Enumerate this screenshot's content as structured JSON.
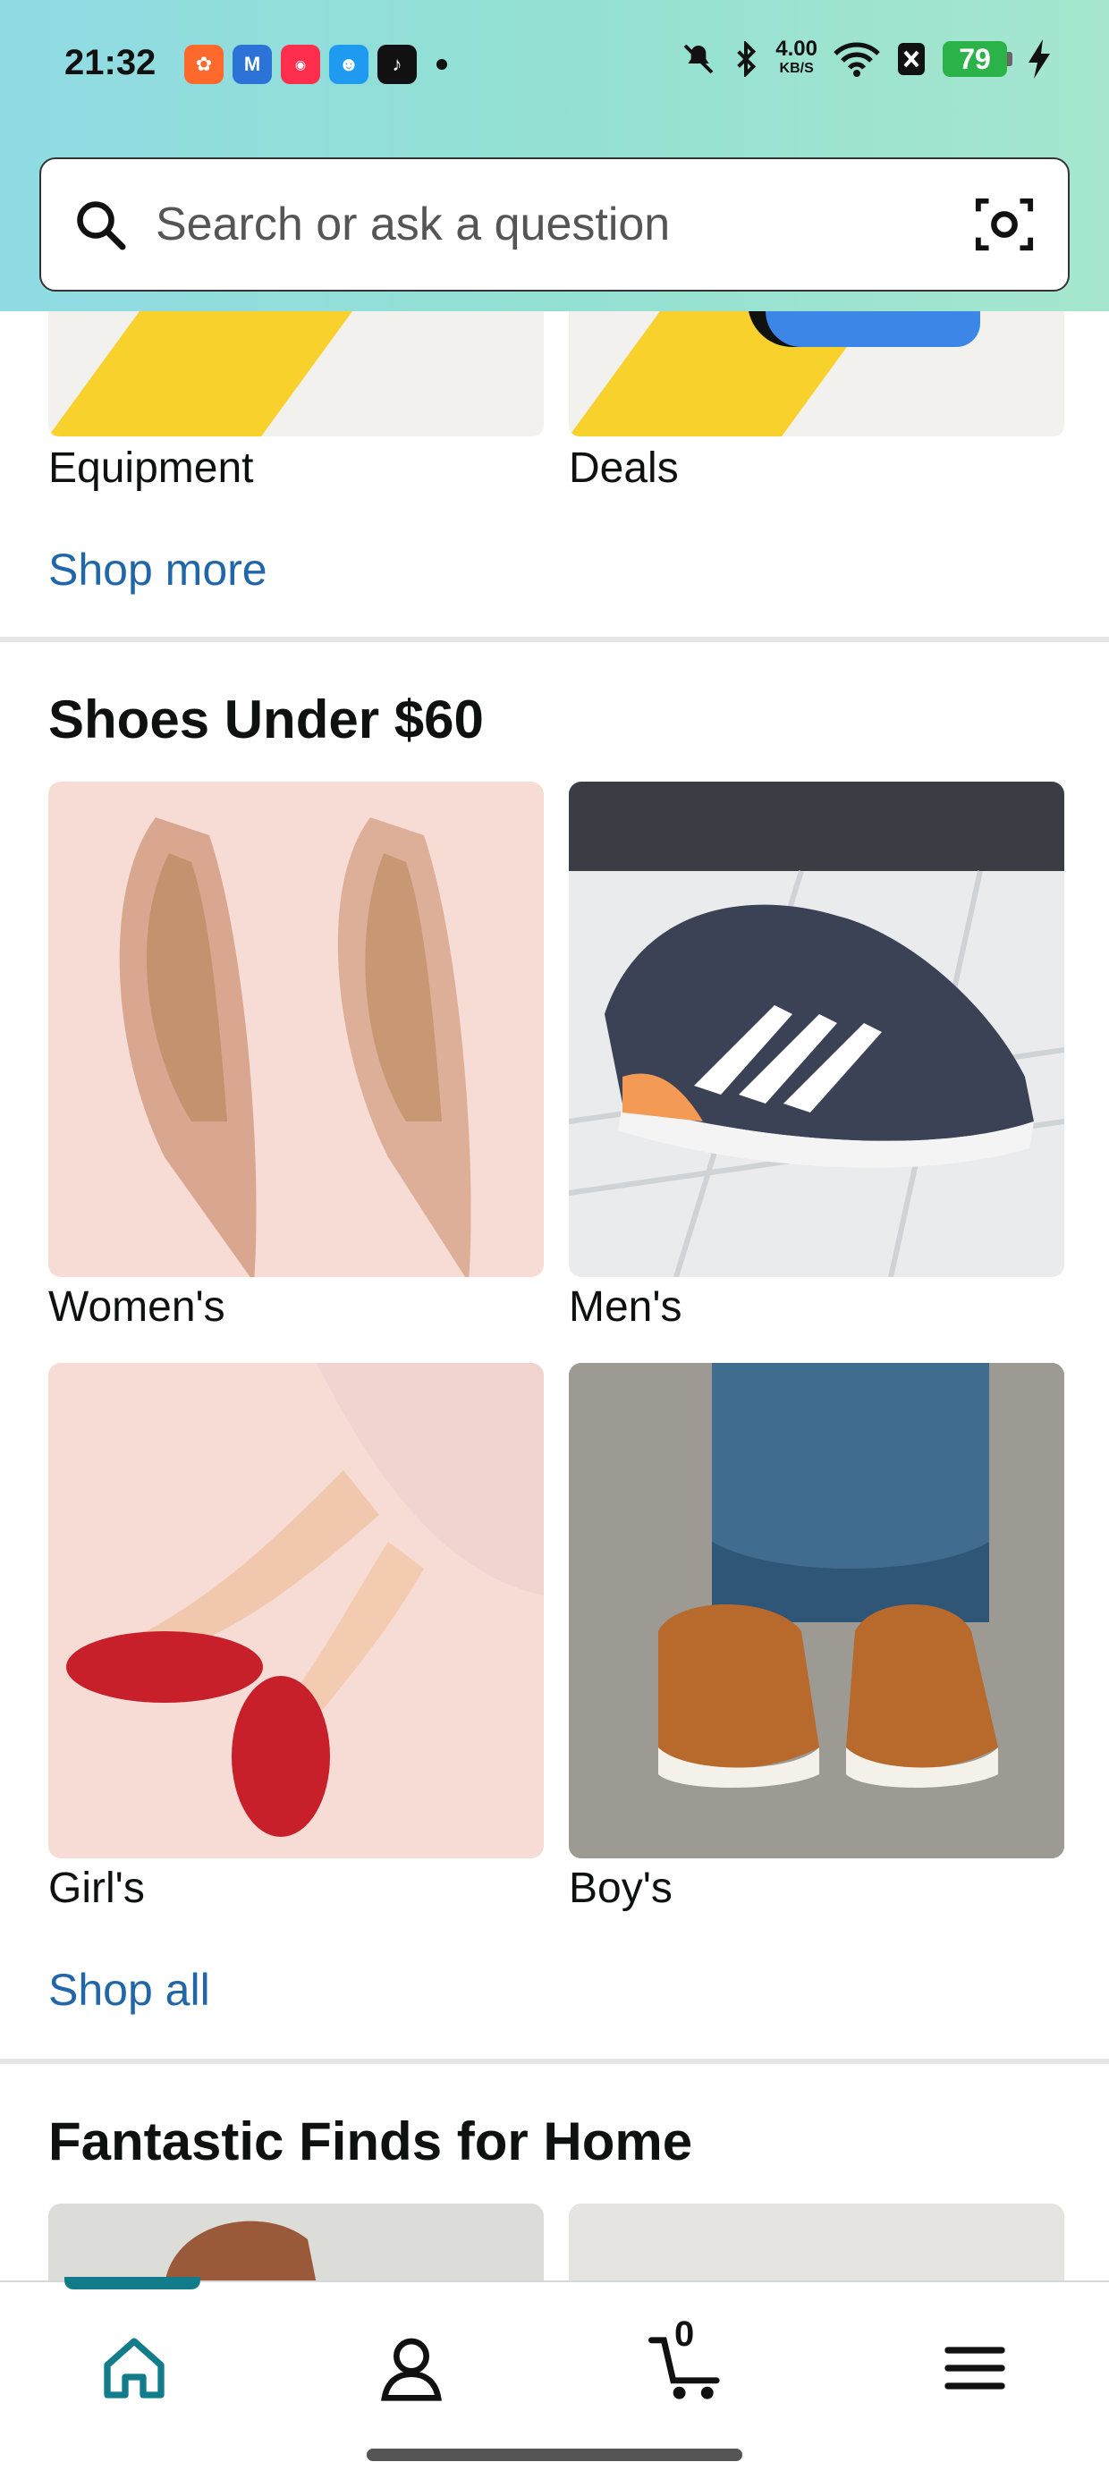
{
  "status_bar": {
    "time": "21:32",
    "network_speed": "4.00",
    "network_unit": "KB/S",
    "battery": "79"
  },
  "search": {
    "placeholder": "Search or ask a question"
  },
  "categories": [
    {
      "label": "Equipment"
    },
    {
      "label": "Deals"
    }
  ],
  "shop_more": "Shop more",
  "shoes_section": {
    "title": "Shoes Under $60",
    "items": [
      {
        "label": "Women's"
      },
      {
        "label": "Men's"
      },
      {
        "label": "Girl's"
      },
      {
        "label": "Boy's"
      }
    ],
    "shop_all": "Shop all"
  },
  "home_section": {
    "title": "Fantastic Finds for Home"
  },
  "bottom_nav": {
    "cart_count": "0",
    "active": "home"
  },
  "colors": {
    "link": "#2066a8",
    "accent": "#137c8b",
    "header_gradient_start": "#8fdbe4",
    "header_gradient_end": "#a6e6cf"
  }
}
